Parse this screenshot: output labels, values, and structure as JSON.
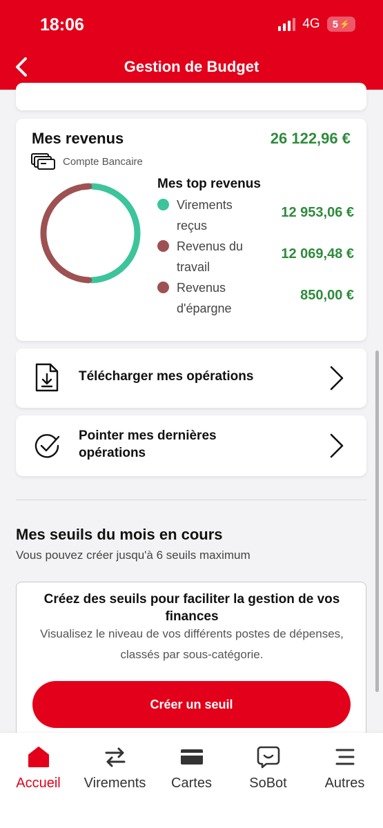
{
  "status": {
    "time": "18:06",
    "network": "4G",
    "battery": "5"
  },
  "header": {
    "title": "Gestion de Budget"
  },
  "revenus": {
    "title": "Mes revenus",
    "total": "26 122,96 €",
    "account": "Compte Bancaire",
    "top_title": "Mes top revenus",
    "items": [
      {
        "label": "Virements reçus",
        "value": "12 953,06 €",
        "color": "#3cc49a",
        "amount": 12953.06
      },
      {
        "label": "Revenus du travail",
        "value": "12 069,48 €",
        "color": "#9e5152",
        "amount": 12069.48
      },
      {
        "label": "Revenus d'épargne",
        "value": "850,00 €",
        "color": "#9e5152",
        "amount": 850.0
      }
    ]
  },
  "actions": {
    "download": "Télécharger mes opérations",
    "point_line1": "Pointer mes dernières",
    "point_line2": "opérations"
  },
  "seuils": {
    "title": "Mes seuils du mois en cours",
    "subtitle": "Vous pouvez créer jusqu'à 6 seuils maximum",
    "card_title": "Créez des seuils pour faciliter la gestion de vos finances",
    "card_desc": "Visualisez le niveau de vos différents postes de dépenses, classés par sous-catégorie.",
    "button": "Créer un seuil"
  },
  "tabs": [
    {
      "label": "Accueil",
      "icon": "home-icon",
      "active": true
    },
    {
      "label": "Virements",
      "icon": "transfer-icon",
      "active": false
    },
    {
      "label": "Cartes",
      "icon": "card-icon",
      "active": false
    },
    {
      "label": "SoBot",
      "icon": "chat-bot-icon",
      "active": false
    },
    {
      "label": "Autres",
      "icon": "menu-icon",
      "active": false
    }
  ],
  "colors": {
    "brand": "#e2001a",
    "positive": "#2e8b3c"
  }
}
